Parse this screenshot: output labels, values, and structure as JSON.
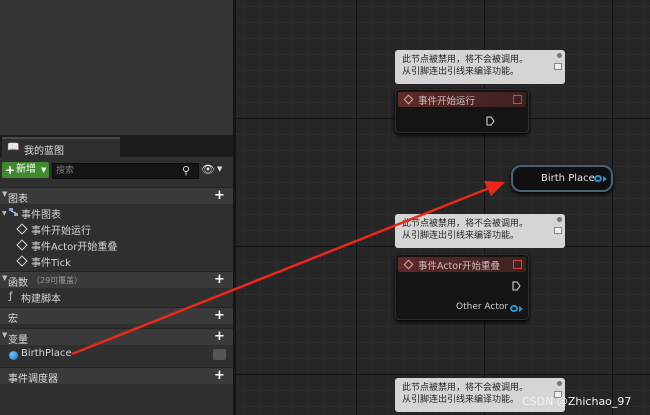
{
  "panel": {
    "tab_label": "我的蓝图",
    "new_button": "新增",
    "search_placeholder": "搜索"
  },
  "sections": {
    "graphs": "图表",
    "event_graph": "事件图表",
    "events": [
      "事件开始运行",
      "事件Actor开始重叠",
      "事件Tick"
    ],
    "functions": "函数",
    "functions_count": "（29可覆盖）",
    "construction_script": "构建脚本",
    "macros": "宏",
    "variables": "变量",
    "variable_items": [
      "BirthPlace"
    ],
    "event_dispatchers": "事件调度器"
  },
  "graph": {
    "disabled_comment_line1": "此节点被禁用，将不会被调用。",
    "disabled_comment_line2": "从引脚连出引线来编译功能。",
    "node_begin_play": "事件开始运行",
    "node_actor_overlap": "事件Actor开始重叠",
    "node_actor_overlap_pin": "Other Actor",
    "variable_node": "Birth Place"
  },
  "watermark": "CSDN @Zhichao_97",
  "colors": {
    "accent_green": "#3f8a2c",
    "event_header": "#5e2a2a",
    "object_pin": "#2e94d6",
    "annotation_arrow": "#e8291c"
  }
}
